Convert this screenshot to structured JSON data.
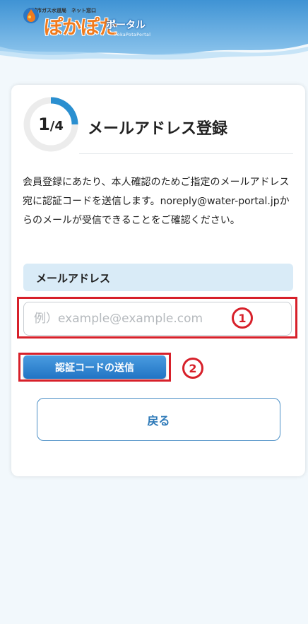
{
  "header": {
    "logo_subtitle": "上越市ガス水道局　ネット窓口",
    "logo_main": "ぽかぽた",
    "logo_portal": "ポータル",
    "logo_roman": "PokaPotaPortal"
  },
  "progress": {
    "current": "1",
    "total": "/4",
    "fraction": 0.25
  },
  "page_title": "メールアドレス登録",
  "description": "会員登録にあたり、本人確認のためご指定のメールアドレス宛に認証コードを送信します。noreply@water-portal.jpからのメールが受信できることをご確認ください。",
  "email_field": {
    "label": "メールアドレス",
    "value": "",
    "placeholder": "例）example@example.com"
  },
  "markers": {
    "one": "1",
    "two": "2"
  },
  "buttons": {
    "send_code": "認証コードの送信",
    "back": "戻る"
  },
  "colors": {
    "accent": "#2d79b8",
    "highlight": "#d7202a",
    "progress_ring": "#2a8fd0",
    "label_bg": "#d9ebf7"
  }
}
